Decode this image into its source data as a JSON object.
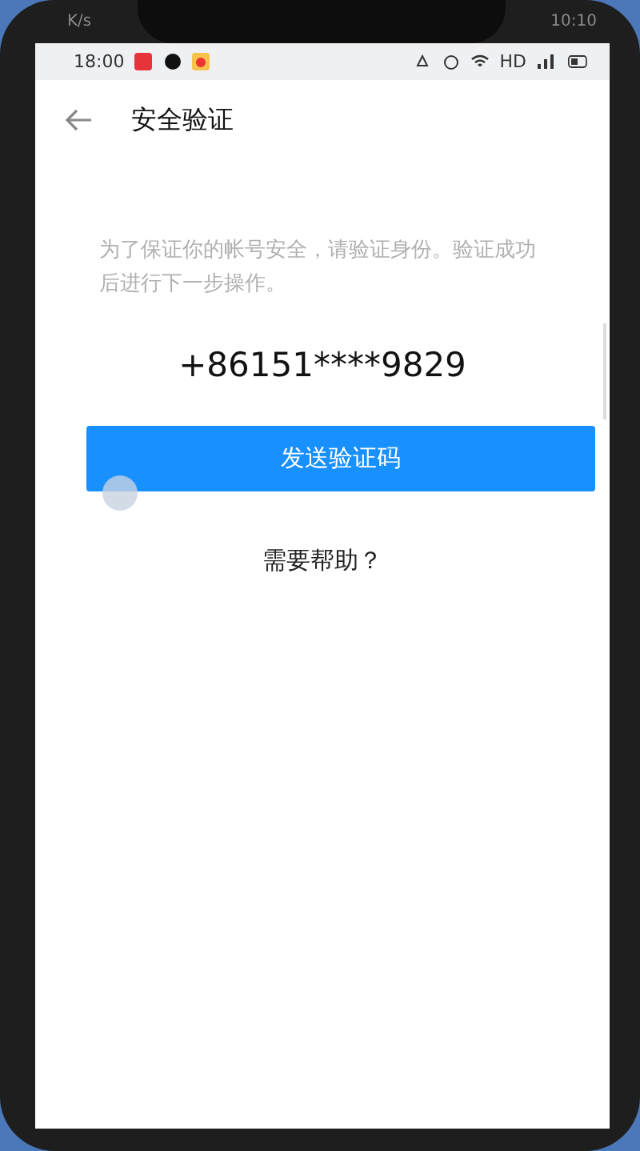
{
  "device_status": {
    "speed": "K/s",
    "time": "10:10"
  },
  "status_bar": {
    "time": "18:00",
    "network": "HD"
  },
  "header": {
    "title": "安全验证"
  },
  "description": "为了保证你的帐号安全，请验证身份。验证成功后进行下一步操作。",
  "phone_number": "+86151****9829",
  "send_button": "发送验证码",
  "help_link": "需要帮助？"
}
